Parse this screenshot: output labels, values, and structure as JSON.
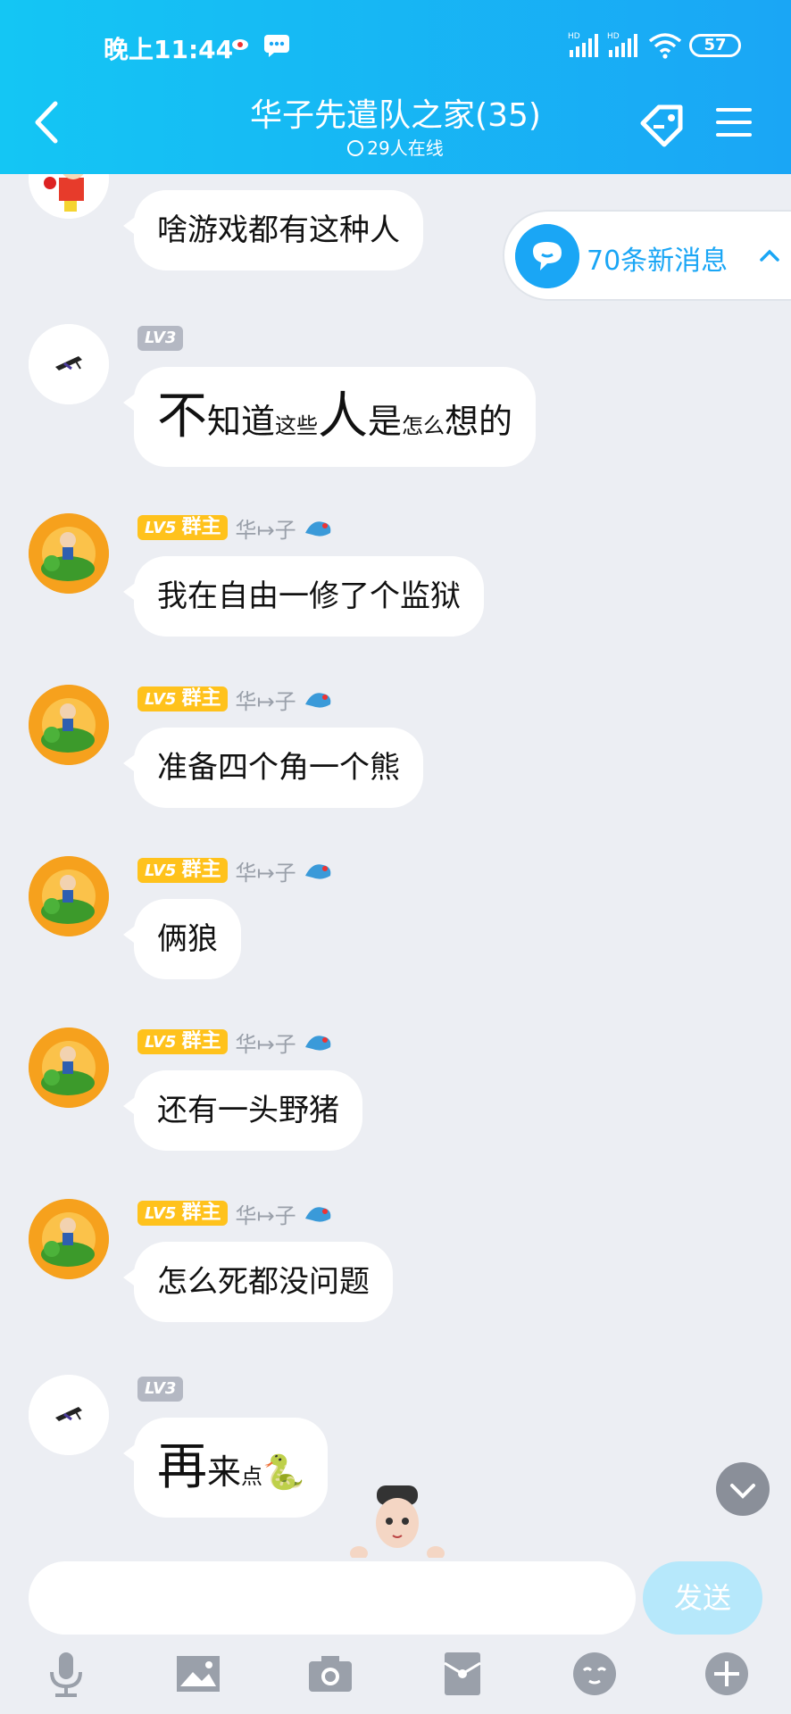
{
  "status_bar": {
    "time": "晚上11:44",
    "battery": "57",
    "signal1": "HD",
    "signal2": "HD"
  },
  "header": {
    "title": "华子先遣队之家(35)",
    "online": "29人在线"
  },
  "new_messages": {
    "label": "70条新消息"
  },
  "messages": [
    {
      "text": "啥游戏都有这种人"
    },
    {
      "level": "LV3",
      "parts": [
        "不",
        "知道",
        "这些",
        "人",
        "是",
        "怎么",
        "想的"
      ]
    },
    {
      "level": "LV5",
      "role": "群主",
      "nick": "华↦子",
      "text": "我在自由一修了个监狱"
    },
    {
      "level": "LV5",
      "role": "群主",
      "nick": "华↦子",
      "text": "准备四个角一个熊"
    },
    {
      "level": "LV5",
      "role": "群主",
      "nick": "华↦子",
      "text": "俩狼"
    },
    {
      "level": "LV5",
      "role": "群主",
      "nick": "华↦子",
      "text": "还有一头野猪"
    },
    {
      "level": "LV5",
      "role": "群主",
      "nick": "华↦子",
      "text": "怎么死都没问题"
    },
    {
      "level": "LV3",
      "parts": [
        "再",
        "来",
        "点",
        "🐍"
      ]
    }
  ],
  "input": {
    "placeholder": "",
    "send_label": "发送"
  },
  "toolbar": [
    "microphone-icon",
    "image-icon",
    "camera-icon",
    "red-packet-icon",
    "emoji-icon",
    "plus-icon"
  ],
  "colors": {
    "header_start": "#14c6f4",
    "header_end": "#1aa6f5",
    "gold": "#ffc21c",
    "gray_badge": "#b4b8c3",
    "background": "#eceef3"
  }
}
